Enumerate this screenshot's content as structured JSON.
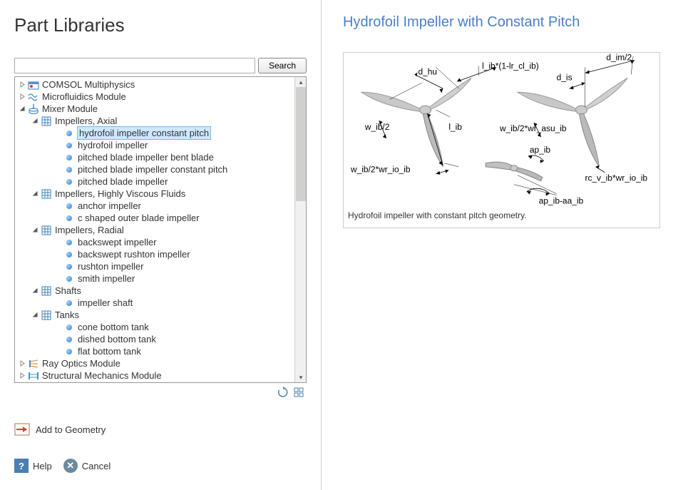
{
  "panel_title": "Part Libraries",
  "search": {
    "placeholder": "",
    "button_label": "Search"
  },
  "tree": [
    {
      "label": "COMSOL Multiphysics",
      "level": 0,
      "expander": "closed",
      "icon": "comsol"
    },
    {
      "label": "Microfluidics Module",
      "level": 0,
      "expander": "closed",
      "icon": "wave"
    },
    {
      "label": "Mixer Module",
      "level": 0,
      "expander": "open",
      "icon": "mixer"
    },
    {
      "label": "Impellers, Axial",
      "level": 1,
      "expander": "open",
      "icon": "table"
    },
    {
      "label": "hydrofoil impeller constant pitch",
      "level": 2,
      "expander": "none",
      "icon": "bullet",
      "selected": true
    },
    {
      "label": "hydrofoil impeller",
      "level": 2,
      "expander": "none",
      "icon": "bullet"
    },
    {
      "label": "pitched blade impeller bent blade",
      "level": 2,
      "expander": "none",
      "icon": "bullet"
    },
    {
      "label": "pitched blade impeller constant pitch",
      "level": 2,
      "expander": "none",
      "icon": "bullet"
    },
    {
      "label": "pitched blade impeller",
      "level": 2,
      "expander": "none",
      "icon": "bullet"
    },
    {
      "label": "Impellers, Highly Viscous Fluids",
      "level": 1,
      "expander": "open",
      "icon": "table"
    },
    {
      "label": "anchor impeller",
      "level": 2,
      "expander": "none",
      "icon": "bullet"
    },
    {
      "label": "c shaped outer blade impeller",
      "level": 2,
      "expander": "none",
      "icon": "bullet"
    },
    {
      "label": "Impellers, Radial",
      "level": 1,
      "expander": "open",
      "icon": "table"
    },
    {
      "label": "backswept impeller",
      "level": 2,
      "expander": "none",
      "icon": "bullet"
    },
    {
      "label": "backswept rushton impeller",
      "level": 2,
      "expander": "none",
      "icon": "bullet"
    },
    {
      "label": "rushton impeller",
      "level": 2,
      "expander": "none",
      "icon": "bullet"
    },
    {
      "label": "smith impeller",
      "level": 2,
      "expander": "none",
      "icon": "bullet"
    },
    {
      "label": "Shafts",
      "level": 1,
      "expander": "open",
      "icon": "table"
    },
    {
      "label": "impeller shaft",
      "level": 2,
      "expander": "none",
      "icon": "bullet"
    },
    {
      "label": "Tanks",
      "level": 1,
      "expander": "open",
      "icon": "table"
    },
    {
      "label": "cone bottom tank",
      "level": 2,
      "expander": "none",
      "icon": "bullet"
    },
    {
      "label": "dished bottom tank",
      "level": 2,
      "expander": "none",
      "icon": "bullet"
    },
    {
      "label": "flat bottom tank",
      "level": 2,
      "expander": "none",
      "icon": "bullet"
    },
    {
      "label": "Ray Optics Module",
      "level": 0,
      "expander": "closed",
      "icon": "ray"
    },
    {
      "label": "Structural Mechanics Module",
      "level": 0,
      "expander": "closed",
      "icon": "struct"
    }
  ],
  "actions": {
    "add_to_geometry": "Add to Geometry",
    "help": "Help",
    "cancel": "Cancel"
  },
  "detail": {
    "title": "Hydrofoil Impeller with Constant Pitch",
    "description": "Hydrofoil impeller with constant pitch geometry.",
    "labels": {
      "d_hu": "d_hu",
      "l_ib_expr": "l_ib*(1-lr_cl_ib)",
      "d_im2": "d_im/2",
      "d_is": "d_is",
      "w_ib2": "w_ib/2",
      "l_ib": "l_ib",
      "w_ib2_asu": "w_ib/2*wr_asu_ib",
      "w_ib2_io": "w_ib/2*wr_io_ib",
      "ap_ib": "ap_ib",
      "rc_v": "rc_v_ib*wr_io_ib",
      "ap_ib_aa": "ap_ib-aa_ib"
    }
  }
}
